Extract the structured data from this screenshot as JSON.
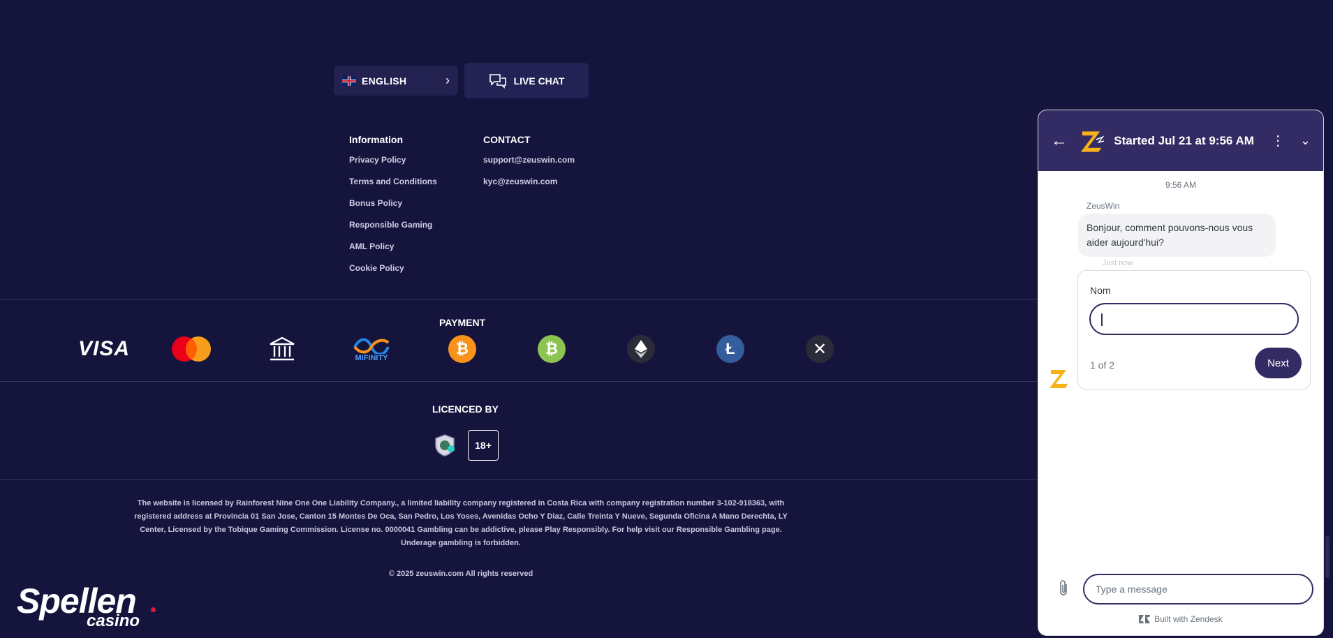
{
  "top_buttons": {
    "language": "ENGLISH",
    "live_chat": "LIVE CHAT"
  },
  "information": {
    "heading": "Information",
    "links": [
      "Privacy Policy",
      "Terms and Conditions",
      "Bonus Policy",
      "Responsible Gaming",
      "AML Policy",
      "Cookie Policy"
    ]
  },
  "contact": {
    "heading": "CONTACT",
    "emails": [
      "support@zeuswin.com",
      "kyc@zeuswin.com"
    ]
  },
  "payment": {
    "heading": "PAYMENT",
    "visa_label": "VISA",
    "mifinity_label": "MIFINITY",
    "methods": [
      "visa",
      "mastercard",
      "bank-transfer",
      "mifinity",
      "bitcoin",
      "bitcoin-cash",
      "ethereum",
      "litecoin",
      "ripple"
    ]
  },
  "licence": {
    "heading": "LICENCED BY",
    "age_badge": "18+"
  },
  "legal_text": "The website is licensed by Rainforest Nine One One Liability Company., a limited liability company registered in Costa Rica with company registration number 3-102-918363, with registered address at Provincia 01 San Jose, Canton 15 Montes De Oca, San Pedro, Los Yoses, Avenidas Ocho Y Diaz, Calle Treinta Y Nueve, Segunda Oficina A Mano Derechta, LY Center, Licensed by the Tobique Gaming Commission. License no. 0000041 Gambling can be addictive, please Play Responsibly. For help visit our Responsible Gambling page. Underage gambling is forbidden.",
  "copyright": "© 2025 zeuswin.com All rights reserved",
  "logo": {
    "main": "Spellen",
    "sub": "casino"
  },
  "chat_widget": {
    "title": "Started Jul 21 at 9:56 AM",
    "time": "9:56 AM",
    "sender": "ZeusWin",
    "message": "Bonjour, comment pouvons-nous vous aider aujourd'hui?",
    "message_age": "Just now",
    "form_label": "Nom",
    "form_value": "",
    "step": "1 of 2",
    "next_label": "Next",
    "input_placeholder": "Type a message",
    "built_with": "Built with Zendesk"
  },
  "colors": {
    "page_bg": "#15143d",
    "widget_accent": "#332b63",
    "bitcoin": "#f7931a",
    "bitcoin_cash": "#8dc351",
    "litecoin": "#345d9d"
  }
}
